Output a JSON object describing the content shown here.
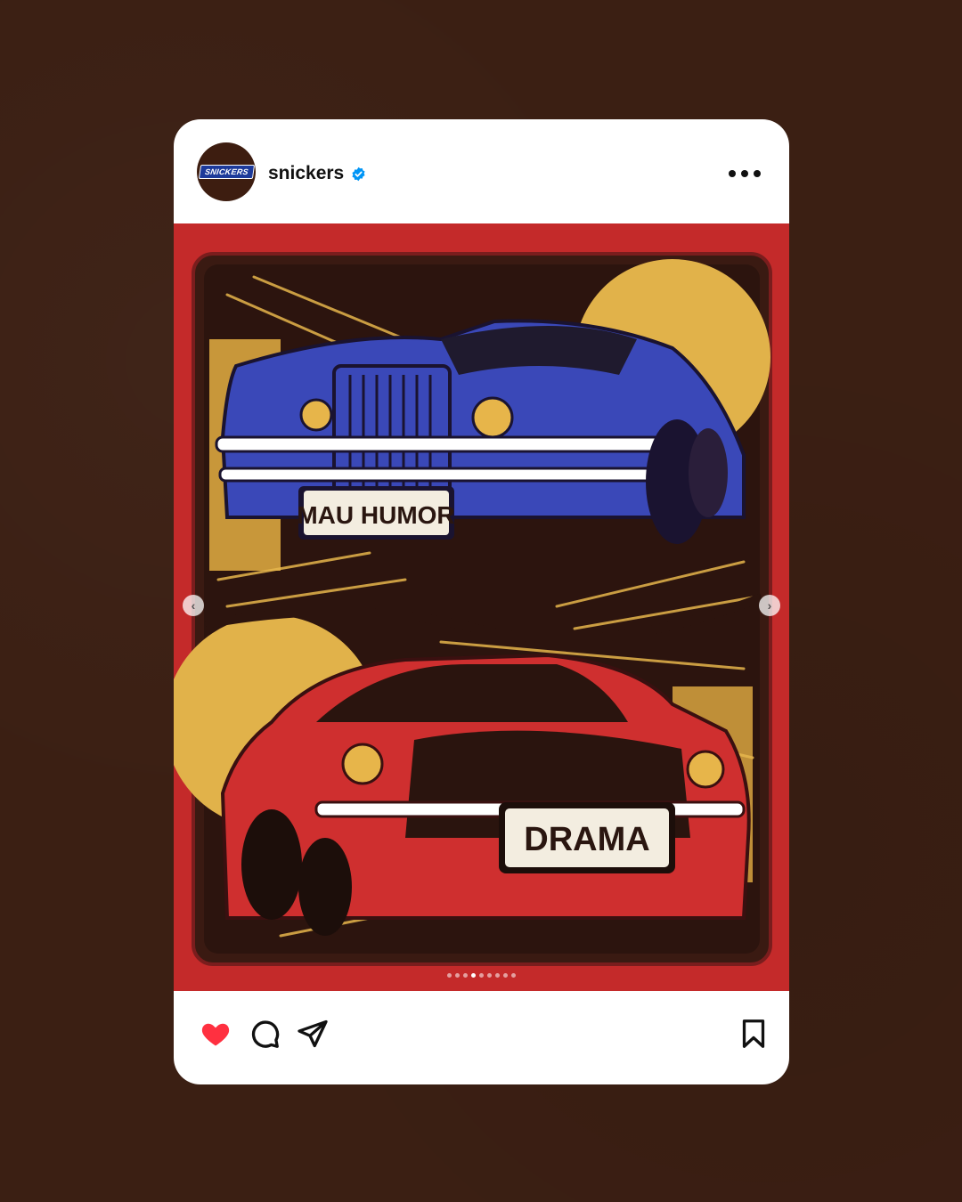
{
  "post": {
    "username": "snickers",
    "avatar_logo": "SNICKERS",
    "verified": true
  },
  "media": {
    "plate_top": "MAU HUMOR",
    "plate_bottom": "DRAMA",
    "carousel_total": 9,
    "carousel_active_index": 3
  },
  "colors": {
    "background": "#3b1f13",
    "card": "#ffffff",
    "poster_red": "#c42a2a",
    "like_red": "#ff3040",
    "verified_blue": "#0095f6"
  },
  "icons": {
    "like": "heart-filled-icon",
    "comment": "comment-bubble-icon",
    "share": "paper-plane-icon",
    "save": "bookmark-icon",
    "more": "more-horizontal-icon"
  }
}
